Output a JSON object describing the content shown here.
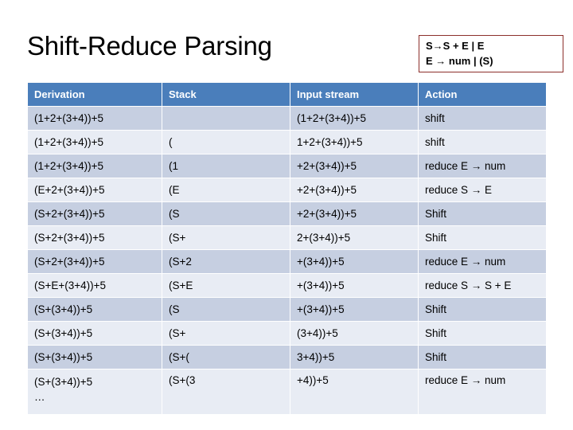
{
  "slide": {
    "title": "Shift-Reduce Parsing"
  },
  "grammar": {
    "lines": [
      "S→S + E | E",
      "E → num | (S)"
    ],
    "border_color": "#8C2F2B"
  },
  "table": {
    "header_bg": "#4A7EBB",
    "band_dark": "#C6CFE1",
    "band_light": "#E8ECF4",
    "columns": [
      "Derivation",
      "Stack",
      "Input stream",
      "Action"
    ],
    "rows": [
      {
        "derivation": "(1+2+(3+4))+5",
        "stack": "",
        "input": "(1+2+(3+4))+5",
        "action": "shift"
      },
      {
        "derivation": "(1+2+(3+4))+5",
        "stack": "(",
        "input": "1+2+(3+4))+5",
        "action": "shift"
      },
      {
        "derivation": "(1+2+(3+4))+5",
        "stack": "(1",
        "input": "+2+(3+4))+5",
        "action": "reduce E → num"
      },
      {
        "derivation": "(E+2+(3+4))+5",
        "stack": "(E",
        "input": "+2+(3+4))+5",
        "action": "reduce S → E"
      },
      {
        "derivation": "(S+2+(3+4))+5",
        "stack": "(S",
        "input": "+2+(3+4))+5",
        "action": "Shift"
      },
      {
        "derivation": "(S+2+(3+4))+5",
        "stack": "(S+",
        "input": "2+(3+4))+5",
        "action": "Shift"
      },
      {
        "derivation": "(S+2+(3+4))+5",
        "stack": "(S+2",
        "input": "+(3+4))+5",
        "action": "reduce E → num"
      },
      {
        "derivation": "(S+E+(3+4))+5",
        "stack": "(S+E",
        "input": "+(3+4))+5",
        "action": "reduce S → S + E"
      },
      {
        "derivation": "(S+(3+4))+5",
        "stack": "(S",
        "input": "+(3+4))+5",
        "action": "Shift"
      },
      {
        "derivation": "(S+(3+4))+5",
        "stack": "(S+",
        "input": "(3+4))+5",
        "action": "Shift"
      },
      {
        "derivation": "(S+(3+4))+5",
        "stack": "(S+(",
        "input": "3+4))+5",
        "action": "Shift"
      },
      {
        "derivation": "(S+(3+4))+5",
        "derivation_continuation": "…",
        "stack": "(S+(3",
        "input": "+4))+5",
        "action": "reduce E → num"
      }
    ]
  }
}
